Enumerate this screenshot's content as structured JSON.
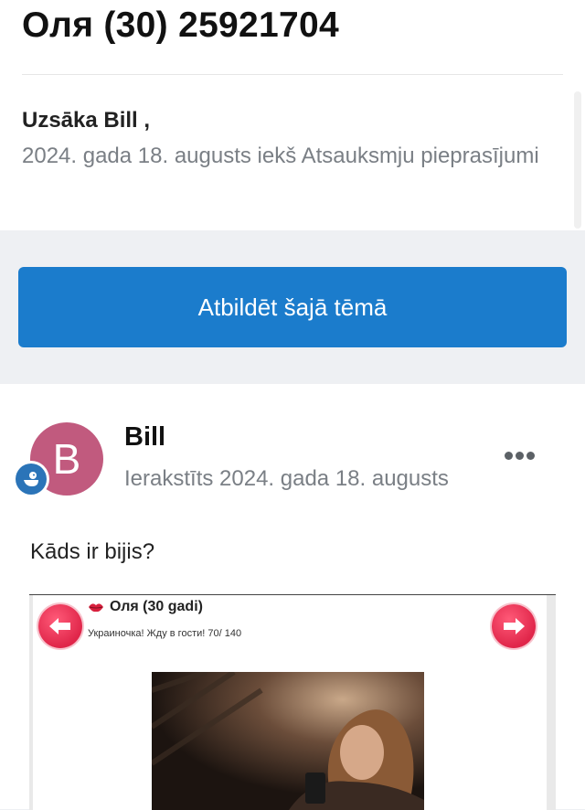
{
  "topic": {
    "title": "Оля (30) 25921704",
    "started_by": "Uzsāka Bill ,",
    "meta": "2024. gada 18. augusts iekš Atsauksmju pieprasījumi"
  },
  "reply_button": {
    "label": "Atbildēt šajā tēmā"
  },
  "post": {
    "avatar_letter": "B",
    "author": "Bill",
    "date": "Ierakstīts 2024. gada 18. augusts",
    "text": "Kāds ir bijis?",
    "embed": {
      "title": "Оля (30 gadi)",
      "subtitle": "Украиночка! Жду в гости! 70/ 140"
    }
  },
  "colors": {
    "accent": "#1b7ccc",
    "avatar": "#c15a7e",
    "badge": "#2b74b8",
    "nav_arrow": "#e0264a"
  },
  "icons": [
    "more-options-icon",
    "rank-badge-icon",
    "arrow-left-icon",
    "arrow-right-icon",
    "lips-icon"
  ]
}
